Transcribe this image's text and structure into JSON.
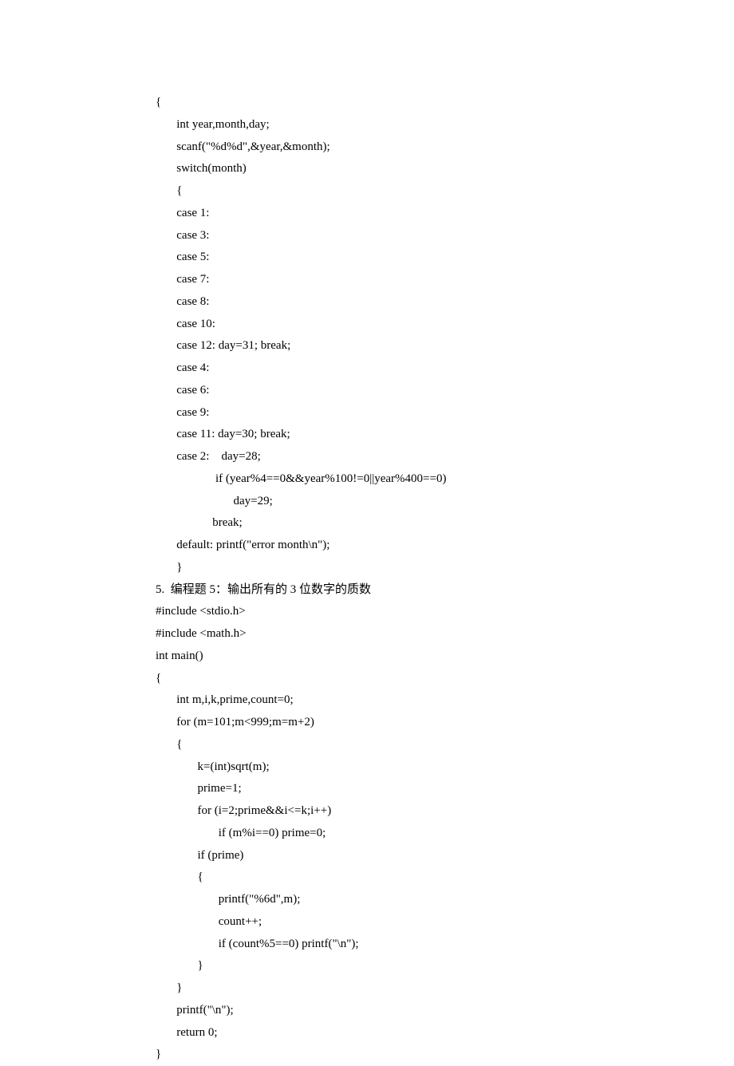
{
  "code1": {
    "lines": [
      "{",
      "       int year,month,day;",
      "       scanf(\"%d%d\",&year,&month);",
      "       switch(month)",
      "       {",
      "       case 1:",
      "       case 3:",
      "       case 5:",
      "       case 7:",
      "       case 8:",
      "       case 10:",
      "       case 12: day=31; break;",
      "       case 4:",
      "       case 6:",
      "       case 9:",
      "       case 11: day=30; break;",
      "       case 2:    day=28;",
      "                    if (year%4==0&&year%100!=0||year%400==0)",
      "                          day=29;",
      "                   break;",
      "       default: printf(\"error month\\n\");",
      "       }"
    ]
  },
  "heading": "5.  编程题 5：输出所有的 3 位数字的质数",
  "code2": {
    "lines": [
      "#include <stdio.h>",
      "#include <math.h>",
      "int main()",
      "{",
      "       int m,i,k,prime,count=0;",
      "       for (m=101;m<999;m=m+2)",
      "       {",
      "              k=(int)sqrt(m);",
      "              prime=1;",
      "              for (i=2;prime&&i<=k;i++)",
      "                     if (m%i==0) prime=0;",
      "              if (prime)",
      "              {",
      "                     printf(\"%6d\",m);",
      "                     count++;",
      "                     if (count%5==0) printf(\"\\n\");",
      "              }",
      "       }",
      "       printf(\"\\n\");",
      "       return 0;",
      "}"
    ]
  }
}
